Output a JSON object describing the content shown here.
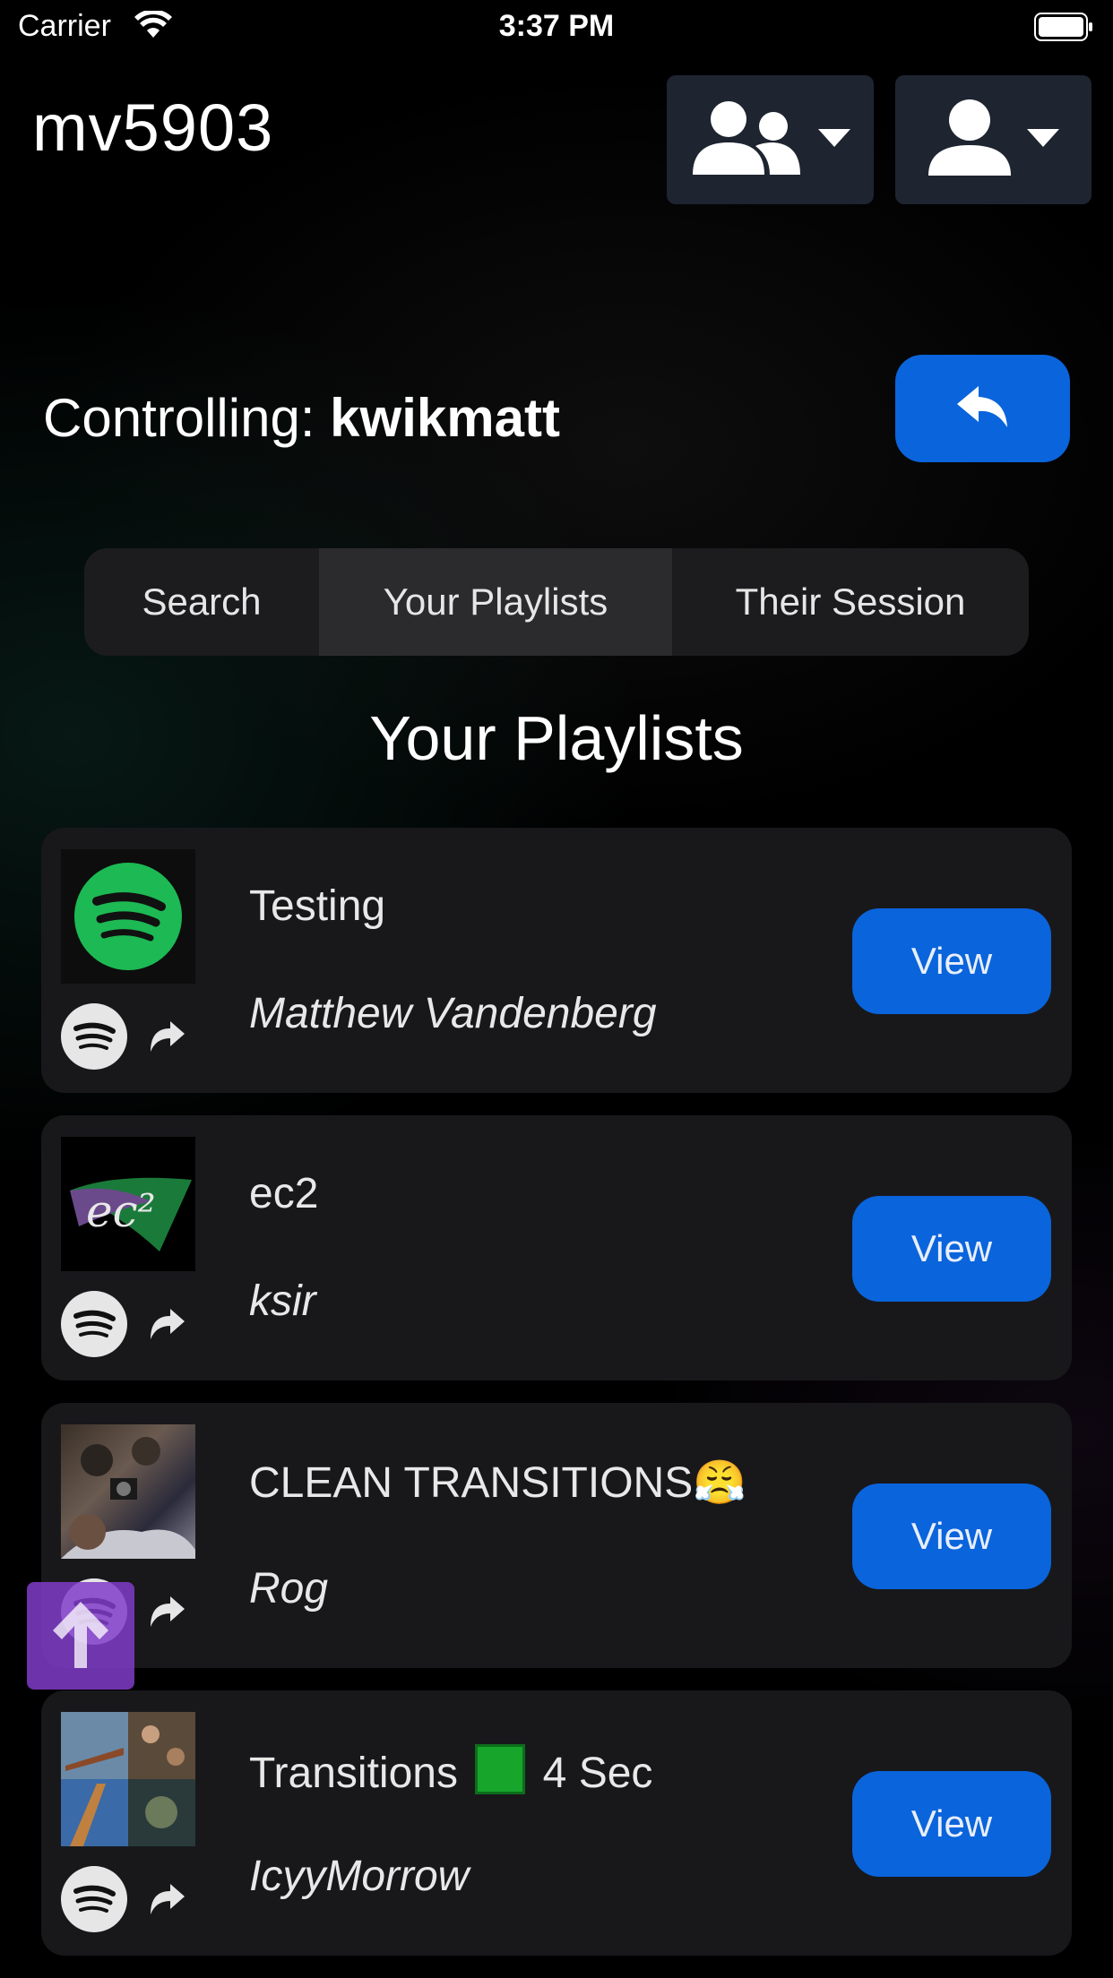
{
  "status_bar": {
    "carrier": "Carrier",
    "time": "3:37 PM"
  },
  "header": {
    "username": "mv5903"
  },
  "controlling": {
    "label": "Controlling:",
    "target": "kwikmatt"
  },
  "tabs": [
    {
      "label": "Search",
      "active": false
    },
    {
      "label": "Your Playlists",
      "active": true
    },
    {
      "label": "Their Session",
      "active": false
    }
  ],
  "section_title": "Your Playlists",
  "playlists": [
    {
      "name": "Testing",
      "owner": "Matthew Vandenberg",
      "view_label": "View",
      "cover": "spotify-logo"
    },
    {
      "name": "ec2",
      "owner": "ksir",
      "view_label": "View",
      "cover": "ec2-logo",
      "cover_text": "ec²"
    },
    {
      "name": "CLEAN TRANSITIONS😤",
      "owner": "Rog",
      "view_label": "View",
      "cover": "photo-collage"
    },
    {
      "name_prefix": "Transitions",
      "name_suffix": "4 Sec",
      "owner": "IcyyMorrow",
      "view_label": "View",
      "cover": "photo-grid"
    }
  ],
  "colors": {
    "accent": "#0a64db",
    "spotify_green": "#1db954",
    "scroll_top": "#803cc8"
  }
}
